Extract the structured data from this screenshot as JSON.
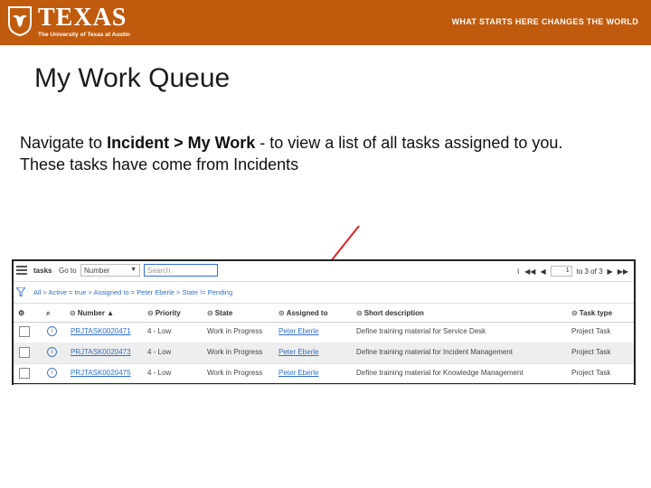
{
  "banner": {
    "wordmark": "TEXAS",
    "subline": "The University of Texas at Austin",
    "tagline": "WHAT STARTS HERE CHANGES THE WORLD",
    "color": "#c05a0d"
  },
  "slide": {
    "title": "My Work Queue",
    "body_prefix": "Navigate to ",
    "body_bold": "Incident > My Work",
    "body_suffix": " -  to view a list of all tasks assigned to you. These tasks have come from Incidents"
  },
  "screenshot": {
    "toolbar": {
      "label": "tasks",
      "goto": "Go to",
      "field_value": "Number",
      "search_placeholder": "Search",
      "page_value": "1",
      "page_count": "to 3 of 3"
    },
    "breadcrumb": "All > Active = true > Assigned to = Peter Eberle > State != Pending",
    "columns": [
      "Number ▲",
      "Priority",
      "State",
      "Assigned to",
      "Short description",
      "Task type"
    ],
    "rows": [
      {
        "number": "PRJTASK0020471",
        "priority": "4 - Low",
        "state": "Work in Progress",
        "assigned": "Peter Eberle",
        "desc": "Define training material for Service Desk",
        "type": "Project Task"
      },
      {
        "number": "PRJTASK0020473",
        "priority": "4 - Low",
        "state": "Work in Progress",
        "assigned": "Peter Eberle",
        "desc": "Define training material for Incident Management",
        "type": "Project Task"
      },
      {
        "number": "PRJTASK0020475",
        "priority": "4 - Low",
        "state": "Work in Progress",
        "assigned": "Peter Eberle",
        "desc": "Define training material for Knowledge Management",
        "type": "Project Task"
      }
    ]
  }
}
